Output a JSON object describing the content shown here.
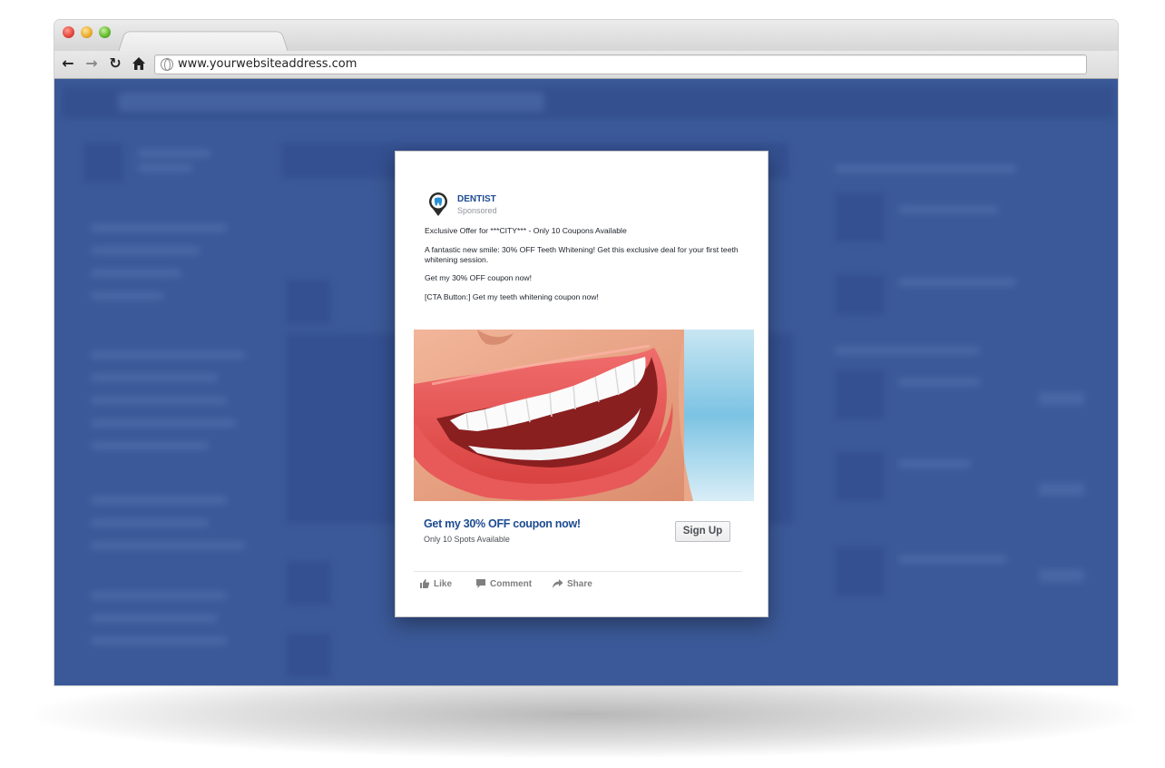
{
  "browser": {
    "url": "www.yourwebsiteaddress.com"
  },
  "ad": {
    "brand_name": "DENTIST",
    "sponsored_label": "Sponsored",
    "logo_icon": "tooth-location-pin-icon",
    "paragraphs": [
      "Exclusive Offer for ***CITY*** - Only 10 Coupons Available",
      "A fantastic new smile: 30% OFF Teeth Whitening! Get this exclusive deal for your first teeth whitening session.",
      "Get my 30% OFF coupon now!",
      "[CTA Button:] Get my teeth whitening coupon now!"
    ],
    "image_alt_icon": "smile-photo",
    "cta_headline": "Get my 30% OFF coupon now!",
    "cta_subtext": "Only 10 Spots Available",
    "cta_button_label": "Sign Up",
    "actions": [
      {
        "label": "Like",
        "icon": "thumbs-up-icon"
      },
      {
        "label": "Comment",
        "icon": "comment-icon"
      },
      {
        "label": "Share",
        "icon": "share-icon"
      }
    ]
  },
  "colors": {
    "background_overlay": "#3b5998",
    "brand_blue": "#1d4b91"
  }
}
